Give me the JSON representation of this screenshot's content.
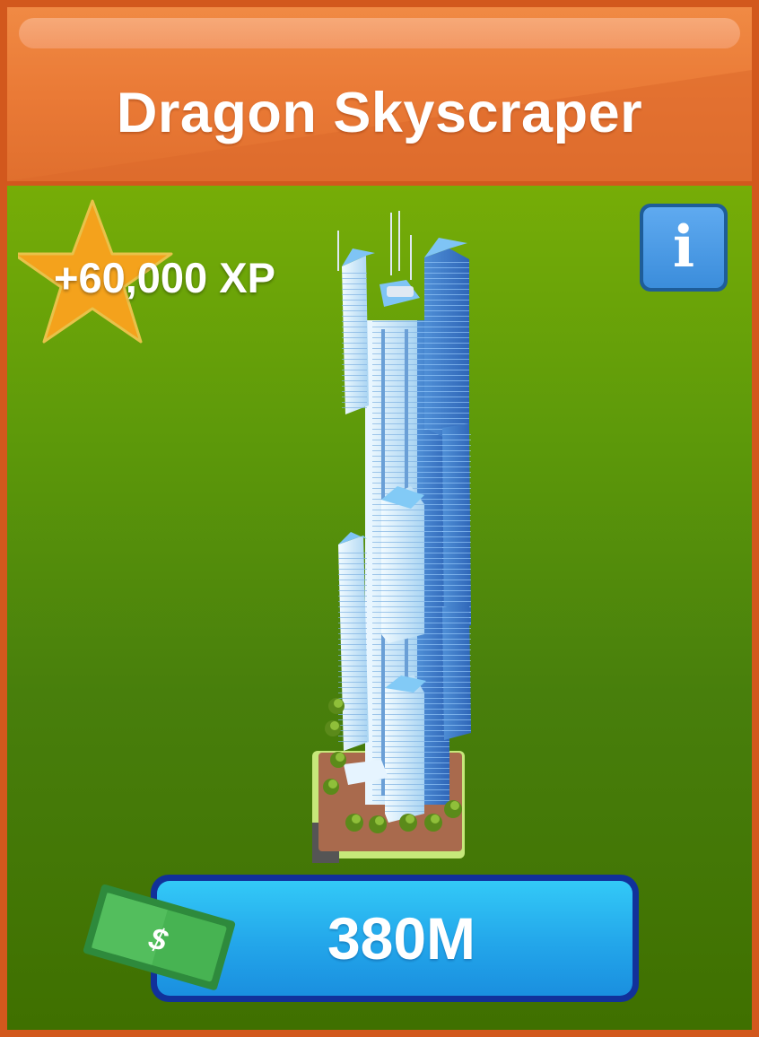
{
  "header": {
    "title": "Dragon Skyscraper"
  },
  "reward": {
    "xp_label": "+60,000 XP"
  },
  "info_button": {
    "glyph": "i"
  },
  "purchase": {
    "price": "380M",
    "currency_symbol": "$"
  },
  "icons": {
    "reward": "star-icon",
    "info": "info-icon",
    "currency": "cash-icon",
    "item": "skyscraper-icon"
  },
  "colors": {
    "frame": "#d2581d",
    "header": "#ea7a36",
    "panel_top": "#76ad07",
    "panel_bottom": "#3f7000",
    "star": "#f4a21c",
    "info_button": "#3b8ddb",
    "price_button": "#23a6ea",
    "price_button_border": "#11319a",
    "cash": "#3aa84a"
  }
}
